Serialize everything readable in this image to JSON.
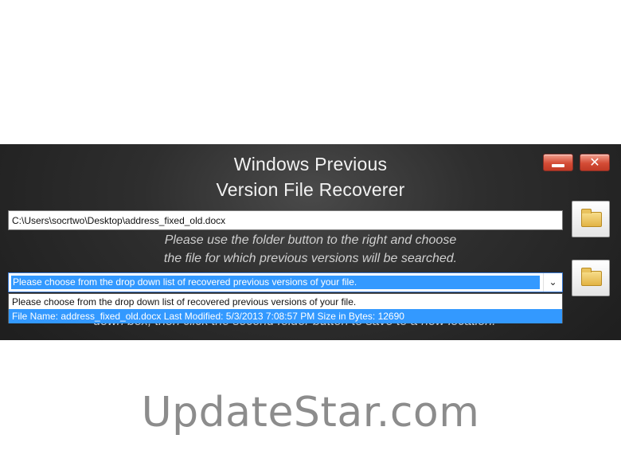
{
  "window": {
    "title_line_1": "Windows Previous",
    "title_line_2": "Version File Recoverer",
    "minimize_icon": "minimize-icon",
    "close_icon": "close-icon",
    "close_glyph": "✕"
  },
  "file_input": {
    "value": "C:\\Users\\socrtwo\\Desktop\\address_fixed_old.docx"
  },
  "instructions": {
    "line_1": "Please use the folder button to the right and choose",
    "line_2": "the file for which previous versions will be searched.",
    "line_3": "down box, then click the second folder button to save to a new location."
  },
  "version_select": {
    "selected": "Please choose from the drop down list of recovered previous versions of your file.",
    "arrow_glyph": "⌄",
    "options": [
      "Please choose from the drop down list of recovered previous versions of your file.",
      "File Name: address_fixed_old.docx Last Modified: 5/3/2013 7:08:57 PM Size in Bytes: 12690"
    ],
    "highlighted_index": 1
  },
  "folder_buttons": {
    "icon": "folder-icon"
  },
  "colors": {
    "selection": "#3399ff",
    "window_button": "#d44c36"
  },
  "watermark": {
    "text": "UpdateStar.com"
  }
}
